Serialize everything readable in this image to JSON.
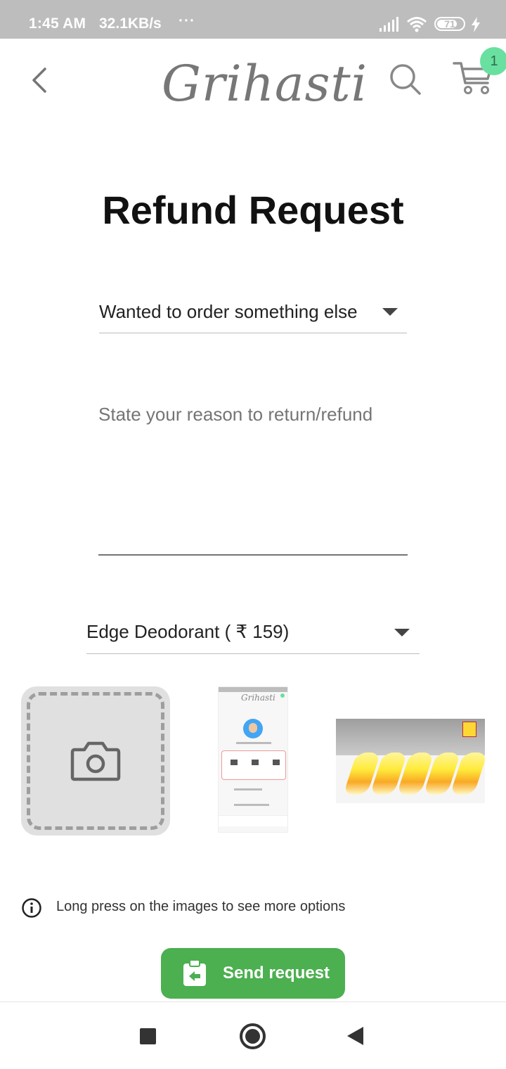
{
  "status_bar": {
    "time": "1:45 AM",
    "speed": "32.1KB/s",
    "dots": "···",
    "battery_level": "71",
    "icons": [
      "signal-icon",
      "wifi-icon",
      "battery-icon",
      "charging-icon"
    ]
  },
  "app_bar": {
    "logo_text": "Grihasti",
    "cart_badge": "1",
    "icons": [
      "back-arrow-icon",
      "search-icon",
      "cart-icon"
    ]
  },
  "page": {
    "title": "Refund Request"
  },
  "form": {
    "reason_dropdown_value": "Wanted to order something else",
    "reason_placeholder": "State your reason to return/refund",
    "product_dropdown_value": "Edge Deodorant ( ₹ 159)"
  },
  "images": {
    "add_photo_icon": "camera-icon",
    "thumbnails": [
      "screenshot-thumbnail",
      "food-thumbnail"
    ]
  },
  "info": {
    "text": "Long press on the images to see more options",
    "icon": "info-icon"
  },
  "send_button": {
    "label": "Send request",
    "icon": "return-clipboard-icon"
  },
  "colors": {
    "accent_green": "#4caf50",
    "badge_green": "#69e0a0",
    "status_bar_gray": "#bdbdbd"
  }
}
